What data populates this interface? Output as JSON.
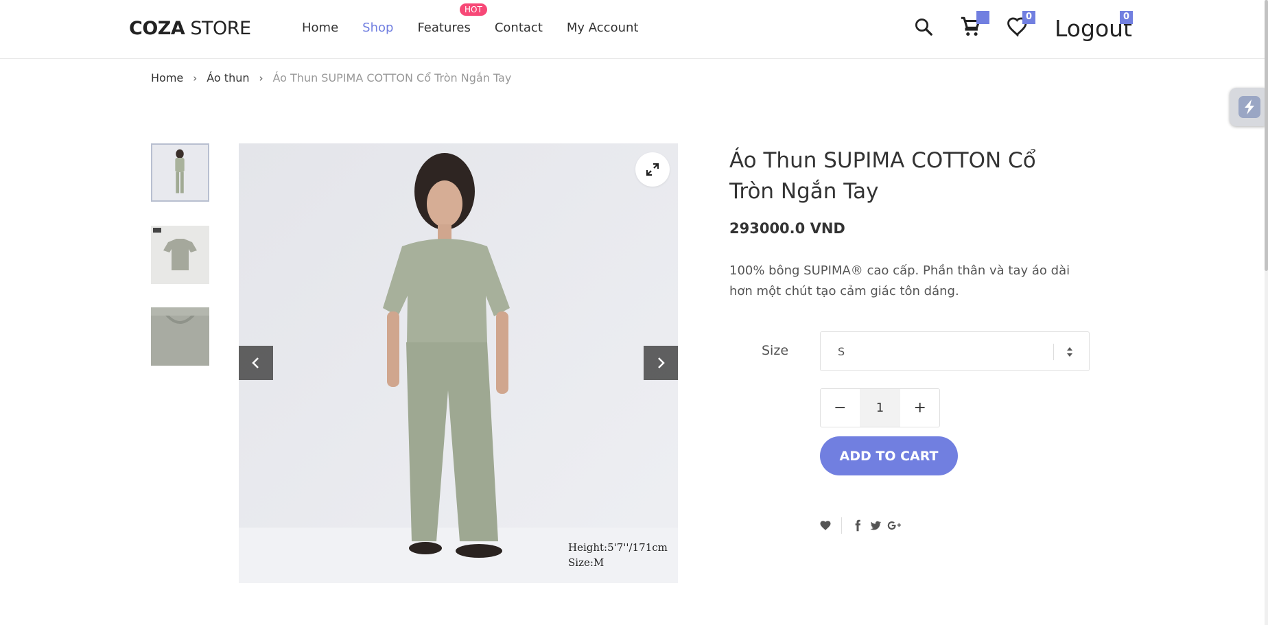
{
  "header": {
    "logo_bold": "COZA",
    "logo_light": " STORE",
    "nav": [
      {
        "label": "Home",
        "active": false
      },
      {
        "label": "Shop",
        "active": true
      },
      {
        "label": "Features",
        "active": false
      },
      {
        "label": "Contact",
        "active": false
      },
      {
        "label": "My Account",
        "active": false
      }
    ],
    "hot_badge": "HOT",
    "cart_count": "",
    "wishlist_count": "0",
    "logout_label": "Logout",
    "logout_count": "0"
  },
  "breadcrumb": {
    "home": "Home",
    "category": "Áo thun",
    "current": "Áo Thun SUPIMA COTTON Cổ Tròn Ngắn Tay"
  },
  "gallery": {
    "caption_line1": "Height:5'7''/171cm",
    "caption_line2": "Size:M"
  },
  "product": {
    "title": "Áo Thun SUPIMA COTTON Cổ Tròn Ngắn Tay",
    "price": "293000.0 VND",
    "description": "100% bông SUPIMA® cao cấp. Phần thân và tay áo dài hơn một chút tạo cảm giác tôn dáng.",
    "size_label": "Size",
    "size_value": "S",
    "quantity": "1",
    "minus": "−",
    "plus": "+",
    "add_to_cart": "ADD TO CART"
  },
  "colors": {
    "accent": "#717fe0",
    "hot": "#f74877"
  }
}
